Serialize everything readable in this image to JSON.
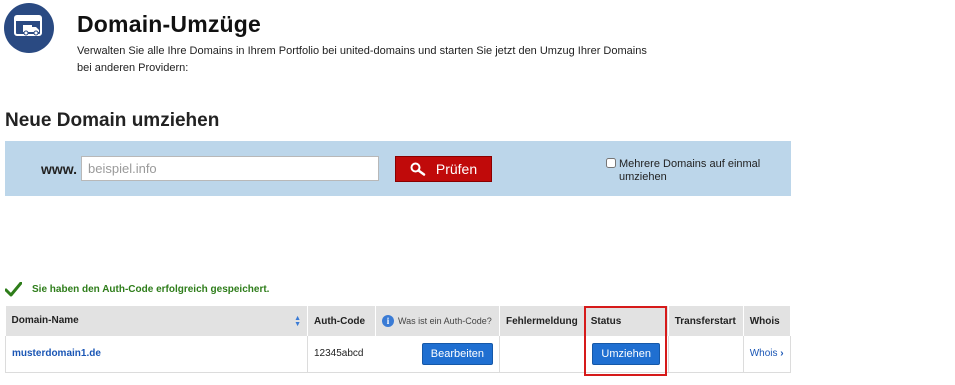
{
  "header": {
    "icon": "truck-transfer-icon",
    "title": "Domain-Umzüge",
    "description": "Verwalten Sie alle Ihre Domains in Ihrem Portfolio bei united-domains und starten Sie jetzt den Umzug Ihrer Domains bei anderen Providern:"
  },
  "search": {
    "section_title": "Neue Domain umziehen",
    "prefix": "www.",
    "placeholder": "beispiel.info",
    "value": "",
    "check_label": "Prüfen",
    "check_icon": "search-icon",
    "multi_label": "Mehrere Domains auf einmal umziehen",
    "multi_checked": false
  },
  "message": {
    "icon": "checkmark-icon",
    "text": "Sie haben den Auth-Code erfolgreich gespeichert.",
    "color": "#2e7d1a"
  },
  "table": {
    "headers": {
      "domain": "Domain-Name",
      "authcode": "Auth-Code",
      "authcode_hint": "Was ist ein Auth-Code?",
      "error": "Fehlermeldung",
      "status": "Status",
      "transferstart": "Transferstart",
      "whois": "Whois"
    },
    "rows": [
      {
        "domain": "musterdomain1.de",
        "authcode": "12345abcd",
        "edit_label": "Bearbeiten",
        "error": "",
        "status_label": "Umziehen",
        "transferstart": "",
        "whois_label": "Whois"
      }
    ]
  },
  "colors": {
    "accent_blue": "#1f6fd1",
    "panel_bg": "#bcd6ea",
    "check_button": "#c00a0a",
    "highlight": "#d61a1a",
    "header_icon_bg": "#2a4a82"
  }
}
